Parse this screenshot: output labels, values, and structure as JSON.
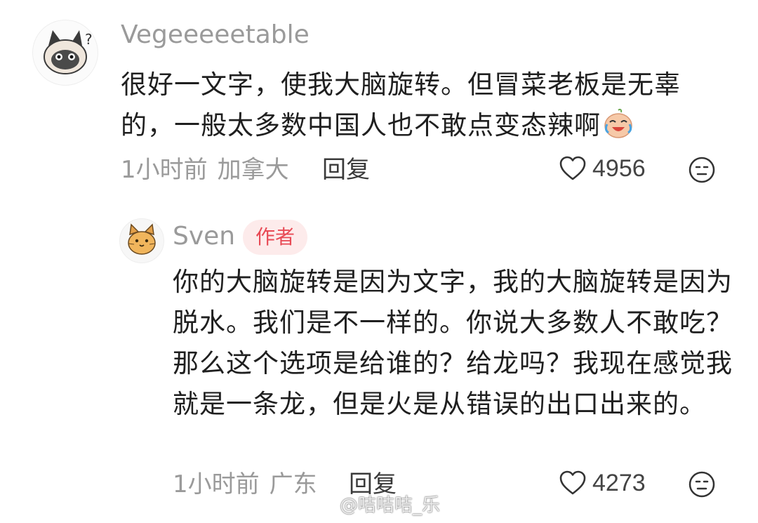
{
  "comments": [
    {
      "username": "Vegeeeeetable",
      "avatar_icon": "cat-question-avatar-icon",
      "text": "很好一文字，使我大脑旋转。但冒菜老板是无辜的，一般太多数中国人也不敢点变态辣啊",
      "emoji_icon": "crying-laughing-emoji-icon",
      "time": "1小时前",
      "location": "加拿大",
      "reply_label": "回复",
      "like_count": "4956"
    },
    {
      "username": "Sven",
      "avatar_icon": "cat-face-avatar-icon",
      "badge": "作者",
      "text": "你的大脑旋转是因为文字，我的大脑旋转是因为脱水。我们是不一样的。你说大多数人不敢吃？那么这个选项是给谁的？给龙吗？我现在感觉我就是一条龙，但是火是从错误的出口出来的。",
      "time": "1小时前",
      "location": "广东",
      "reply_label": "回复",
      "like_count": "4273"
    }
  ],
  "watermark": "@咭咭咭_乐",
  "colors": {
    "username": "#9a9a9a",
    "badge_bg": "#fdebeb",
    "badge_text": "#e84a55",
    "body_text": "#1f1f1f",
    "meta_text": "#9a9a9a"
  }
}
